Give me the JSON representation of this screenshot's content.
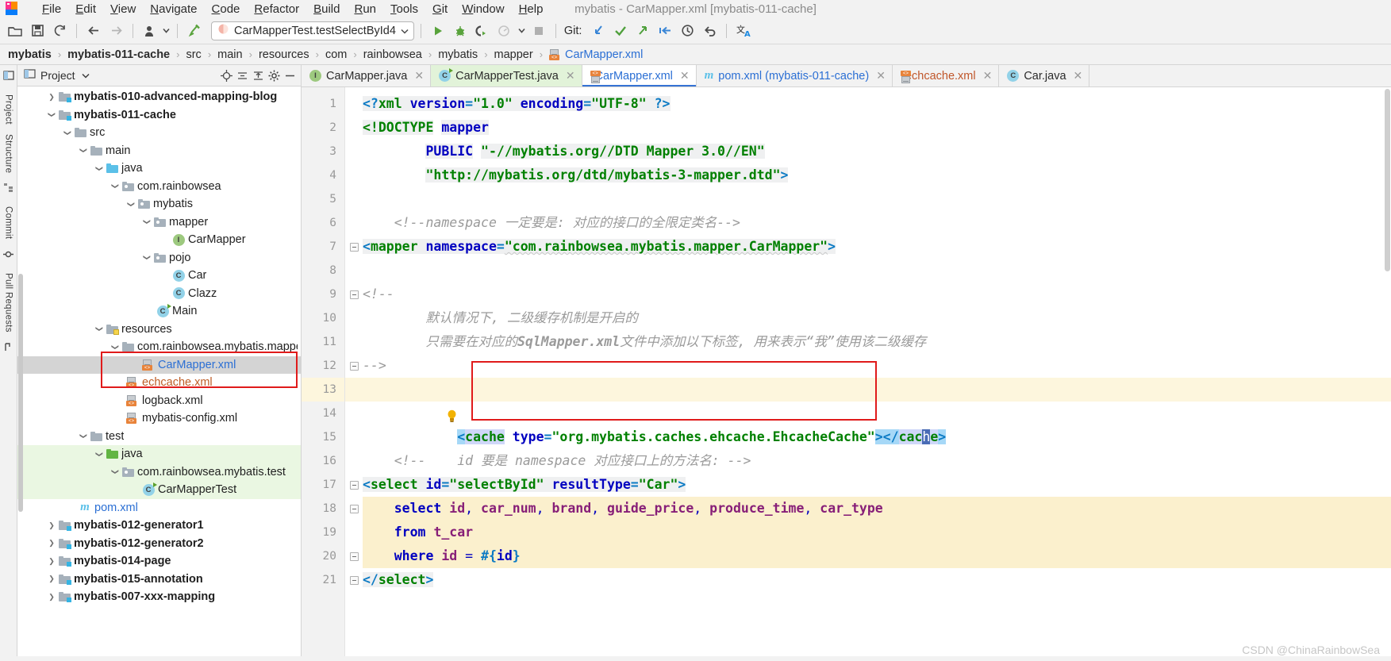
{
  "window": {
    "title": "mybatis - CarMapper.xml [mybatis-011-cache]",
    "watermark": "CSDN @ChinaRainbowSea"
  },
  "menubar": {
    "items": [
      {
        "label": "File",
        "mnemonic": "F"
      },
      {
        "label": "Edit",
        "mnemonic": "E"
      },
      {
        "label": "View",
        "mnemonic": "V"
      },
      {
        "label": "Navigate",
        "mnemonic": "N"
      },
      {
        "label": "Code",
        "mnemonic": "C"
      },
      {
        "label": "Refactor",
        "mnemonic": "R"
      },
      {
        "label": "Build",
        "mnemonic": "B"
      },
      {
        "label": "Run",
        "mnemonic": "R"
      },
      {
        "label": "Tools",
        "mnemonic": "T"
      },
      {
        "label": "Git",
        "mnemonic": "G"
      },
      {
        "label": "Window",
        "mnemonic": "W"
      },
      {
        "label": "Help",
        "mnemonic": "H"
      }
    ]
  },
  "toolbar": {
    "open_project_icon": "open-folder-icon",
    "save_all_icon": "save-all-icon",
    "sync_icon": "refresh-icon",
    "back_icon": "arrow-back-icon",
    "forward_icon": "arrow-forward-icon",
    "profile_icon": "user-avatar-icon",
    "build_icon": "hammer-icon",
    "run_config": {
      "value": "CarMapperTest.testSelectById4",
      "icon": "test-config-icon",
      "dropdown_icon": "chevron-down-icon"
    },
    "run_icon": "run-play-icon",
    "debug_icon": "debug-bug-icon",
    "run_coverage_icon": "run-with-coverage-icon",
    "profiler_icon": "profiler-icon",
    "profiler_dropdown_icon": "chevron-down-icon",
    "stop_icon": "stop-square-icon",
    "git_label": "Git:",
    "git_update_icon": "git-update-arrow-down-icon",
    "git_commit_icon": "git-commit-check-icon",
    "git_push_icon": "git-push-arrow-up-icon",
    "git_pull_icon": "git-pull-icon",
    "history_icon": "clock-history-icon",
    "rollback_icon": "undo-rollback-icon",
    "translate_icon": "translate-icon"
  },
  "breadcrumb": {
    "items": [
      {
        "label": "mybatis",
        "style": "bold"
      },
      {
        "label": "mybatis-011-cache",
        "style": "bold"
      },
      {
        "label": "src",
        "style": "normal"
      },
      {
        "label": "main",
        "style": "normal"
      },
      {
        "label": "resources",
        "style": "normal"
      },
      {
        "label": "com",
        "style": "normal"
      },
      {
        "label": "rainbowsea",
        "style": "normal"
      },
      {
        "label": "mybatis",
        "style": "normal"
      },
      {
        "label": "mapper",
        "style": "normal"
      },
      {
        "label": "CarMapper.xml",
        "style": "link",
        "icon": "xml-file-icon"
      }
    ],
    "separator": "›"
  },
  "left_stripe": {
    "items": [
      {
        "label": "Project",
        "icon": "project-panel-icon"
      },
      {
        "label": "Structure",
        "icon": "structure-panel-icon"
      },
      {
        "label": "Commit",
        "icon": "commit-panel-icon"
      },
      {
        "label": "Pull Requests",
        "icon": "pull-requests-icon"
      }
    ]
  },
  "project_panel": {
    "title": "Project",
    "title_dropdown_icon": "chevron-down-icon",
    "locate_icon": "crosshair-locate-icon",
    "collapse_icon": "collapse-all-icon",
    "expand_icon": "expand-all-icon",
    "settings_icon": "gear-icon",
    "hide_icon": "minimize-icon",
    "tree": [
      {
        "label": "mybatis-010-advanced-mapping-blog",
        "indent": 1,
        "arrow": "collapsed",
        "icon": "module-folder-icon",
        "style": "bold"
      },
      {
        "label": "mybatis-011-cache",
        "indent": 1,
        "arrow": "expanded",
        "icon": "module-folder-icon",
        "style": "bold"
      },
      {
        "label": "src",
        "indent": 2,
        "arrow": "expanded",
        "icon": "folder-icon",
        "style": "normal"
      },
      {
        "label": "main",
        "indent": 3,
        "arrow": "expanded",
        "icon": "folder-icon",
        "style": "normal"
      },
      {
        "label": "java",
        "indent": 4,
        "arrow": "expanded",
        "icon": "source-folder-icon",
        "style": "normal"
      },
      {
        "label": "com.rainbowsea",
        "indent": 5,
        "arrow": "expanded",
        "icon": "package-icon",
        "style": "normal"
      },
      {
        "label": "mybatis",
        "indent": 6,
        "arrow": "expanded",
        "icon": "package-icon",
        "style": "normal"
      },
      {
        "label": "mapper",
        "indent": 7,
        "arrow": "expanded",
        "icon": "package-icon",
        "style": "normal"
      },
      {
        "label": "CarMapper",
        "indent": 9,
        "arrow": "none",
        "icon": "interface-icon",
        "style": "normal"
      },
      {
        "label": "pojo",
        "indent": 7,
        "arrow": "expanded",
        "icon": "package-icon",
        "style": "normal"
      },
      {
        "label": "Car",
        "indent": 9,
        "arrow": "none",
        "icon": "class-icon",
        "style": "normal"
      },
      {
        "label": "Clazz",
        "indent": 9,
        "arrow": "none",
        "icon": "class-icon",
        "style": "normal"
      },
      {
        "label": "Main",
        "indent": 8,
        "arrow": "none",
        "icon": "runnable-class-icon",
        "style": "normal"
      },
      {
        "label": "resources",
        "indent": 4,
        "arrow": "expanded",
        "icon": "resources-folder-icon",
        "style": "normal"
      },
      {
        "label": "com.rainbowsea.mybatis.mapper",
        "indent": 5,
        "arrow": "expanded",
        "icon": "folder-icon",
        "style": "normal"
      },
      {
        "label": "CarMapper.xml",
        "indent": 7,
        "arrow": "none",
        "icon": "xml-file-icon",
        "style": "selected-blue"
      },
      {
        "label": "echcache.xml",
        "indent": 6,
        "arrow": "none",
        "icon": "xml-file-icon",
        "style": "orange"
      },
      {
        "label": "logback.xml",
        "indent": 6,
        "arrow": "none",
        "icon": "xml-file-icon",
        "style": "normal"
      },
      {
        "label": "mybatis-config.xml",
        "indent": 6,
        "arrow": "none",
        "icon": "xml-file-icon",
        "style": "normal"
      },
      {
        "label": "test",
        "indent": 3,
        "arrow": "expanded",
        "icon": "folder-icon",
        "style": "normal"
      },
      {
        "label": "java",
        "indent": 4,
        "arrow": "expanded",
        "icon": "test-source-folder-icon",
        "style": "green-bg"
      },
      {
        "label": "com.rainbowsea.mybatis.test",
        "indent": 5,
        "arrow": "expanded",
        "icon": "package-icon",
        "style": "green-bg"
      },
      {
        "label": "CarMapperTest",
        "indent": 7,
        "arrow": "none",
        "icon": "runnable-class-icon",
        "style": "green-bg"
      },
      {
        "label": "pom.xml",
        "indent": 3,
        "arrow": "none",
        "icon": "maven-icon",
        "style": "link"
      },
      {
        "label": "mybatis-012-generator1",
        "indent": 1,
        "arrow": "collapsed",
        "icon": "module-folder-icon",
        "style": "bold"
      },
      {
        "label": "mybatis-012-generator2",
        "indent": 1,
        "arrow": "collapsed",
        "icon": "module-folder-icon",
        "style": "bold"
      },
      {
        "label": "mybatis-014-page",
        "indent": 1,
        "arrow": "collapsed",
        "icon": "module-folder-icon",
        "style": "bold"
      },
      {
        "label": "mybatis-015-annotation",
        "indent": 1,
        "arrow": "collapsed",
        "icon": "module-folder-icon",
        "style": "bold"
      },
      {
        "label": "mybatis-007-xxx-mapping",
        "indent": 1,
        "arrow": "collapsed",
        "icon": "module-folder-icon",
        "style": "bold"
      }
    ]
  },
  "editor_tabs": [
    {
      "label": "CarMapper.java",
      "icon": "interface-icon",
      "state": "normal",
      "close_icon": "close-icon"
    },
    {
      "label": "CarMapperTest.java",
      "icon": "runnable-class-icon",
      "state": "modified-green",
      "close_icon": "close-icon"
    },
    {
      "label": "CarMapper.xml",
      "icon": "xml-file-icon",
      "state": "active",
      "close_icon": "close-icon"
    },
    {
      "label": "pom.xml (mybatis-011-cache)",
      "icon": "maven-icon",
      "state": "normal",
      "close_icon": "close-icon"
    },
    {
      "label": "echcache.xml",
      "icon": "xml-file-icon",
      "state": "orange",
      "close_icon": "close-icon"
    },
    {
      "label": "Car.java",
      "icon": "class-icon",
      "state": "normal",
      "close_icon": "close-icon"
    }
  ],
  "code": {
    "file": "CarMapper.xml",
    "caret_line": 13,
    "lightbulb_icon": "intention-lightbulb-icon",
    "lines": [
      {
        "n": 1,
        "text": "<?xml version=\"1.0\" encoding=\"UTF-8\" ?>"
      },
      {
        "n": 2,
        "text": "<!DOCTYPE mapper"
      },
      {
        "n": 3,
        "text": "        PUBLIC \"-//mybatis.org//DTD Mapper 3.0//EN\""
      },
      {
        "n": 4,
        "text": "        \"http://mybatis.org/dtd/mybatis-3-mapper.dtd\">"
      },
      {
        "n": 5,
        "text": ""
      },
      {
        "n": 6,
        "text": "<!--namespace 一定要是: 对应的接口的全限定类名-->"
      },
      {
        "n": 7,
        "text": "<mapper namespace=\"com.rainbowsea.mybatis.mapper.CarMapper\">"
      },
      {
        "n": 8,
        "text": ""
      },
      {
        "n": 9,
        "text": "<!--"
      },
      {
        "n": 10,
        "text": "        默认情况下, 二级缓存机制是开启的"
      },
      {
        "n": 11,
        "text": "        只需要在对应的SqlMapper.xml文件中添加以下标签, 用来表示“我”使用该二级缓存"
      },
      {
        "n": 12,
        "text": "-->"
      },
      {
        "n": 13,
        "text": "<cache type=\"org.mybatis.caches.ehcache.EhcacheCache\"></cache>"
      },
      {
        "n": 14,
        "text": ""
      },
      {
        "n": 15,
        "text": ""
      },
      {
        "n": 16,
        "text": "<!--    id 要是 namespace 对应接口上的方法名: -->"
      },
      {
        "n": 17,
        "text": "<select id=\"selectById\" resultType=\"Car\">"
      },
      {
        "n": 18,
        "text": "    select id, car_num, brand, guide_price, produce_time, car_type"
      },
      {
        "n": 19,
        "text": "    from t_car"
      },
      {
        "n": 20,
        "text": "    where id = #{id}"
      },
      {
        "n": 21,
        "text": "</select>"
      }
    ],
    "cache_tag_name": "cache",
    "cache_tag_type_attr": "type",
    "cache_tag_type_value": "org.mybatis.caches.ehcache.EhcacheCache"
  },
  "colors": {
    "accent_blue": "#2b6fd4",
    "annotation_red": "#e01b1b",
    "caret_line_yellow": "#fdf6dd",
    "sql_fragment_bg": "#fbf0cd",
    "selection_lavender": "#cfd7f8",
    "selection_blue": "#a6d8f7",
    "tree_selection_gray": "#d4d4d4",
    "test_scope_green": "#eaf7e2",
    "xml_string_green": "#008000",
    "xml_attr_blue": "#0000c0"
  }
}
